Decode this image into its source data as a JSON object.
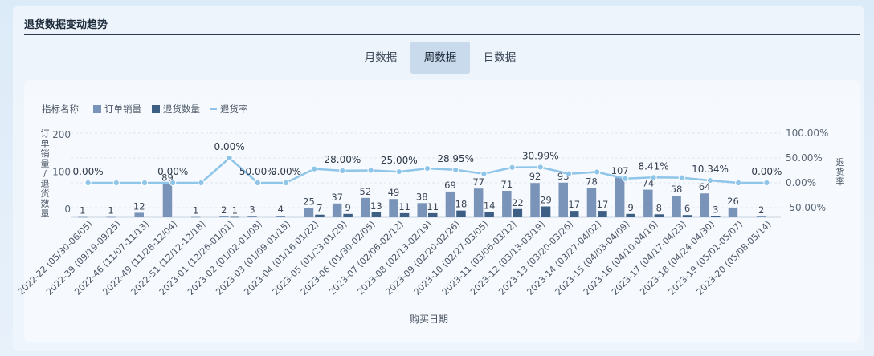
{
  "header": {
    "title": "退货数据变动趋势"
  },
  "tabs": [
    {
      "label": "月数据",
      "active": false
    },
    {
      "label": "周数据",
      "active": true
    },
    {
      "label": "日数据",
      "active": false
    }
  ],
  "chart_data": {
    "type": "bar",
    "legend_title": "指标名称",
    "xlabel": "购买日期",
    "ylabel": "订单销量/退货数量",
    "y2label": "退货率",
    "ylim": [
      0,
      200
    ],
    "yticks": [
      "0",
      "100",
      "200"
    ],
    "y2lim": [
      -50,
      100
    ],
    "y2ticks": [
      "-50.00%",
      "0.00%",
      "50.00%",
      "100.00%"
    ],
    "grid": true,
    "legend_position": "top-left",
    "colors": {
      "orders": "#7a93b8",
      "returns": "#3e5f85",
      "rate": "#8ec5e8"
    },
    "categories": [
      "2022-22 (05/30-06/05)",
      "2022-39 (09/19-09/25)",
      "2022-46 (11/07-11/13)",
      "2022-49 (11/28-12/04)",
      "2022-51 (12/12-12/18)",
      "2023-01 (12/26-01/01)",
      "2023-02 (01/02-01/08)",
      "2023-03 (01/09-01/15)",
      "2023-04 (01/16-01/22)",
      "2023-05 (01/23-01/29)",
      "2023-06 (01/30-02/05)",
      "2023-07 (02/06-02/12)",
      "2023-08 (02/13-02/19)",
      "2023-09 (02/20-02/26)",
      "2023-10 (02/27-03/05)",
      "2023-11 (03/06-03/12)",
      "2023-12 (03/13-03/19)",
      "2023-13 (03/20-03/26)",
      "2023-14 (03/27-04/02)",
      "2023-15 (04/03-04/09)",
      "2023-16 (04/10-04/16)",
      "2023-17 (04/17-04/23)",
      "2023-18 (04/24-04/30)",
      "2023-19 (05/01-05/07)",
      "2023-20 (05/08-05/14)"
    ],
    "series": [
      {
        "name": "订单销量",
        "values": [
          1,
          1,
          12,
          89,
          1,
          2,
          3,
          4,
          25,
          37,
          52,
          49,
          38,
          69,
          77,
          71,
          92,
          93,
          78,
          107,
          74,
          58,
          64,
          26,
          2
        ]
      },
      {
        "name": "退货数量",
        "values": [
          0,
          0,
          0,
          0,
          0,
          1,
          0,
          0,
          7,
          9,
          13,
          11,
          11,
          18,
          14,
          22,
          29,
          17,
          17,
          9,
          8,
          6,
          3,
          0,
          0
        ]
      },
      {
        "name": "退货率",
        "values": [
          0,
          0,
          0,
          0,
          0,
          50,
          0,
          0,
          28,
          24.3,
          25,
          22.4,
          28.95,
          26.1,
          18.2,
          30.99,
          31.5,
          18.3,
          21.8,
          8.41,
          10.8,
          10.34,
          4.7,
          0,
          0
        ]
      }
    ],
    "rate_labels": [
      {
        "index": 0,
        "text": "0.00%"
      },
      {
        "index": 3,
        "text": "0.00%"
      },
      {
        "index": 5,
        "text": "0.00%"
      },
      {
        "index": 6,
        "text": "50.00%"
      },
      {
        "index": 7,
        "text": "0.00%"
      },
      {
        "index": 9,
        "text": "28.00%"
      },
      {
        "index": 11,
        "text": "25.00%"
      },
      {
        "index": 13,
        "text": "28.95%"
      },
      {
        "index": 16,
        "text": "30.99%"
      },
      {
        "index": 20,
        "text": "8.41%"
      },
      {
        "index": 22,
        "text": "10.34%"
      },
      {
        "index": 24,
        "text": "0.00%"
      }
    ]
  }
}
